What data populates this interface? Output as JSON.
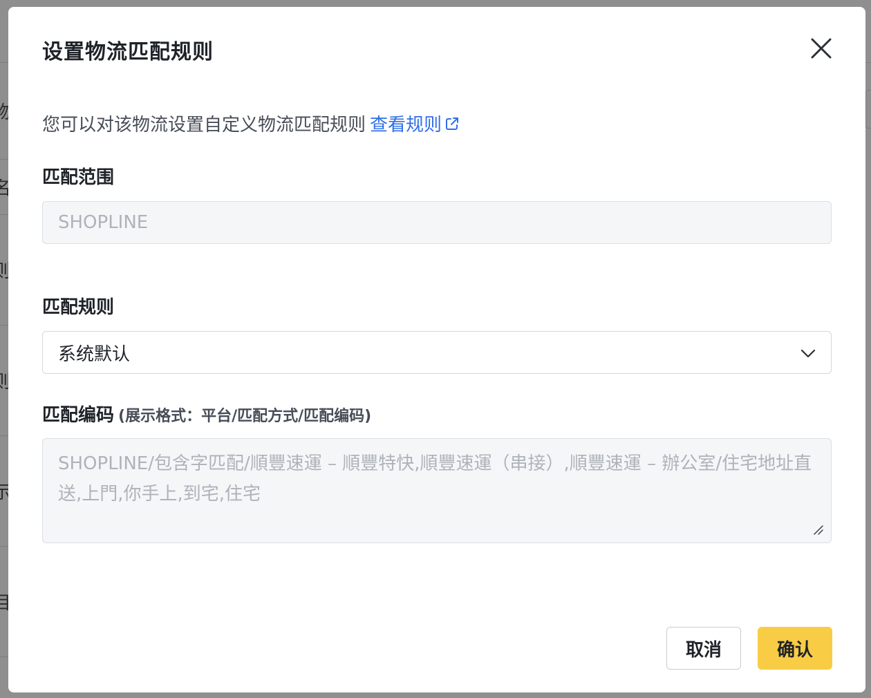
{
  "background": {
    "glyphs": [
      "物",
      "名",
      "则",
      "则",
      "示",
      "目"
    ]
  },
  "modal": {
    "title": "设置物流匹配规则",
    "close_icon": "close-icon",
    "description": "您可以对该物流设置自定义物流匹配规则",
    "view_rules_link": "查看规则",
    "scope": {
      "label": "匹配范围",
      "value": "SHOPLINE"
    },
    "rule": {
      "label": "匹配规则",
      "selected": "系统默认"
    },
    "code": {
      "label": "匹配编码",
      "hint": "(展示格式：平台/匹配方式/匹配编码)",
      "value": "SHOPLINE/包含字匹配/順豐速運 – 順豐特快,順豐速運（串接）,順豐速運 – 辦公室/住宅地址直送,上門,你手上,到宅,住宅"
    },
    "buttons": {
      "cancel": "取消",
      "confirm": "确认"
    }
  },
  "colors": {
    "accent_link": "#2f6ee8",
    "confirm_button": "#f8cd45"
  }
}
